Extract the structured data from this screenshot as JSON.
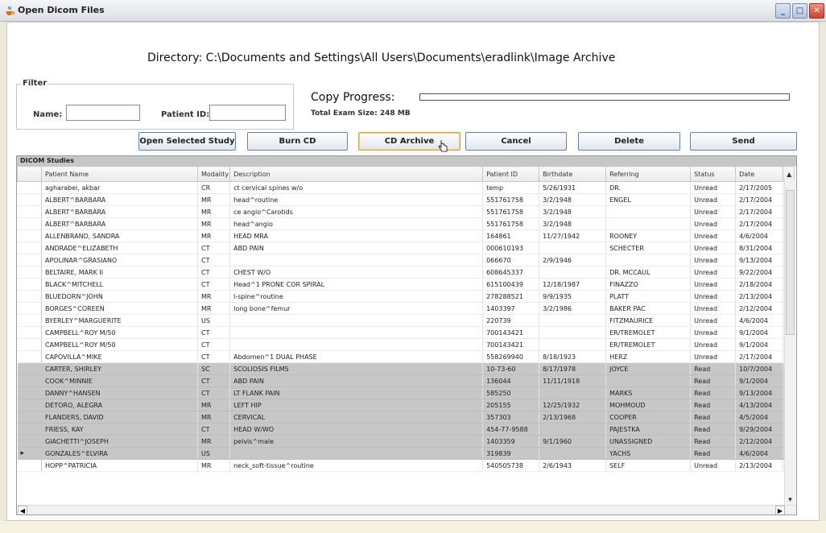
{
  "window": {
    "title": "Open Dicom Files"
  },
  "directory": {
    "label": "Directory: C:\\Documents and Settings\\All Users\\Documents\\eradlink\\Image Archive"
  },
  "filter": {
    "legend": "Filter",
    "name_label": "Name:",
    "name_value": "",
    "patient_id_label": "Patient ID:",
    "patient_id_value": ""
  },
  "copy": {
    "label": "Copy Progress:",
    "total_label": "Total Exam Size:  248 MB",
    "progress": 0
  },
  "buttons": {
    "open": "Open Selected Study",
    "burn": "Burn CD",
    "archive": "CD Archive",
    "cancel": "Cancel",
    "delete": "Delete",
    "send": "Send"
  },
  "table": {
    "caption": "DICOM Studies",
    "columns": [
      "Patient Name",
      "Modality",
      "Description",
      "Patient ID",
      "Birthdate",
      "Referring",
      "Status",
      "Date"
    ],
    "rows": [
      [
        "agharabei, akbar",
        "CR",
        "ct cervical spines w/o",
        "temp",
        "5/26/1931",
        "DR.",
        "Unread",
        "2/17/2005"
      ],
      [
        "ALBERT^BARBARA",
        "MR",
        "head^routine",
        "551761758",
        "3/2/1948",
        "ENGEL",
        "Unread",
        "2/17/2004"
      ],
      [
        "ALBERT^BARBARA",
        "MR",
        "ce angio^Carotids",
        "551761758",
        "3/2/1948",
        "",
        "Unread",
        "2/17/2004"
      ],
      [
        "ALBERT^BARBARA",
        "MR",
        "head^angio",
        "551761758",
        "3/2/1948",
        "",
        "Unread",
        "2/17/2004"
      ],
      [
        "ALLENBRAND, SANDRA",
        "MR",
        "HEAD MRA",
        "164861",
        "11/27/1942",
        "ROONEY",
        "Unread",
        "4/6/2004"
      ],
      [
        "ANDRADE^ELIZABETH",
        "CT",
        "ABD PAIN",
        "000610193",
        "",
        "SCHECTER",
        "Unread",
        "8/31/2004"
      ],
      [
        "APOLINAR^GRASIANO",
        "CT",
        "",
        "066670",
        "2/9/1946",
        "",
        "Unread",
        "9/13/2004"
      ],
      [
        "BELTAIRE, MARK II",
        "CT",
        "CHEST W/O",
        "608645337",
        "",
        "DR. MCCAUL",
        "Unread",
        "9/22/2004"
      ],
      [
        "BLACK^MITCHELL",
        "CT",
        "Head^1 PRONE COR SPIRAL",
        "615100439",
        "12/18/1987",
        "FINAZZO",
        "Unread",
        "2/18/2004"
      ],
      [
        "BLUEDORN^JOHN",
        "MR",
        "l-spine^routine",
        "278288521",
        "9/9/1935",
        "PLATT",
        "Unread",
        "2/13/2004"
      ],
      [
        "BORGES^COREEN",
        "MR",
        "long bone^femur",
        "1403397",
        "3/2/1986",
        "BAKER PAC",
        "Unread",
        "2/12/2004"
      ],
      [
        "BYERLEY^MARGUERITE",
        "US",
        "",
        "220739",
        "",
        "FITZMAURICE",
        "Unread",
        "4/6/2004"
      ],
      [
        "CAMPBELL^ROY M/50",
        "CT",
        "",
        "700143421",
        "",
        "ER/TREMOLET",
        "Unread",
        "9/1/2004"
      ],
      [
        "CAMPBELL^ROY M/50",
        "CT",
        "",
        "700143421",
        "",
        "ER/TREMOLET",
        "Unread",
        "9/1/2004"
      ],
      [
        "CAPOVILLA^MIKE",
        "CT",
        "Abdomen^1 DUAL PHASE",
        "558269940",
        "8/18/1923",
        "HERZ",
        "Unread",
        "2/17/2004"
      ],
      [
        "CARTER, SHIRLEY",
        "SC",
        "SCOLIOSIS FILMS",
        "10-73-60",
        "8/17/1978",
        "JOYCE",
        "Read",
        "10/7/2004"
      ],
      [
        "COOK^MINNIE",
        "CT",
        "ABD PAIN",
        "136044",
        "11/11/1918",
        "",
        "Read",
        "9/1/2004"
      ],
      [
        "DANNY^HANSEN",
        "CT",
        "LT FLANK PAIN",
        "585250",
        "",
        "MARKS",
        "Read",
        "9/13/2004"
      ],
      [
        "DETORO, ALEGRA",
        "MR",
        "LEFT HIP",
        "205155",
        "12/25/1932",
        "MOHMOUD",
        "Read",
        "4/13/2004"
      ],
      [
        "FLANDERS, DAVID",
        "MR",
        "CERVICAL",
        "357303",
        "2/13/1968",
        "COOPER",
        "Read",
        "4/5/2004"
      ],
      [
        "FRIESS, KAY",
        "CT",
        "HEAD W/WO",
        "454-77-9588",
        "",
        "PAJESTKA",
        "Read",
        "9/29/2004"
      ],
      [
        "GIACHETTI^JOSEPH",
        "MR",
        "pelvis^male",
        "1403359",
        "9/1/1960",
        "UNASSIGNED",
        "Read",
        "2/12/2004"
      ],
      [
        "GONZALES^ELVIRA",
        "US",
        "",
        "319839",
        "",
        "YACHS",
        "Read",
        "4/6/2004"
      ],
      [
        "HOPP^PATRICIA",
        "MR",
        "neck_soft-tissue^routine",
        "540505738",
        "2/6/1943",
        "SELF",
        "Unread",
        "2/13/2004"
      ]
    ],
    "selected_row": 22
  },
  "icons": {
    "app": "java-cup-icon",
    "cursor": "mouse-pointer-icon"
  }
}
